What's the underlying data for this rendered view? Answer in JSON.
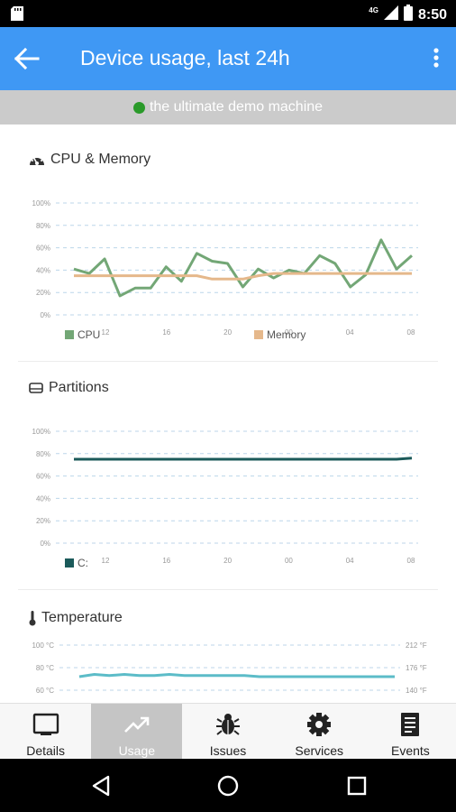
{
  "status_bar": {
    "time": "8:50",
    "network": "4G"
  },
  "app_bar": {
    "title": "Device usage, last 24h"
  },
  "device": {
    "name": "the ultimate demo machine",
    "status_color": "#2a9a2a"
  },
  "colors": {
    "primary": "#3f98f4",
    "cpu": "#73a776",
    "memory": "#e5b88b",
    "partition": "#1b5a5a",
    "temperature": "#5cbcc8",
    "grid": "#bcd6ea"
  },
  "cards": {
    "cpu_memory": {
      "title": "CPU & Memory",
      "icon": "speedometer-icon"
    },
    "partitions": {
      "title": "Partitions",
      "icon": "hard-drive-icon"
    },
    "temperature": {
      "title": "Temperature",
      "icon": "thermometer-icon"
    }
  },
  "chart_data": [
    {
      "type": "line",
      "x_ticks": [
        "12",
        "16",
        "20",
        "00",
        "04",
        "08"
      ],
      "y_ticks": [
        "100%",
        "80%",
        "60%",
        "40%",
        "20%",
        "0%"
      ],
      "ylim": [
        0,
        100
      ],
      "grid": true,
      "legend_position": "bottom",
      "series": [
        {
          "name": "CPU",
          "color": "#73a776",
          "values": [
            41,
            37,
            50,
            17,
            24,
            24,
            43,
            30,
            55,
            48,
            46,
            25,
            41,
            33,
            40,
            37,
            53,
            46,
            25,
            36,
            67,
            41,
            53
          ]
        },
        {
          "name": "Memory",
          "color": "#e5b88b",
          "values": [
            35,
            35,
            35,
            35,
            35,
            35,
            35,
            35,
            35,
            32,
            32,
            32,
            35,
            37,
            37,
            37,
            37,
            37,
            37,
            37,
            37,
            37,
            37
          ]
        }
      ]
    },
    {
      "type": "line",
      "x_ticks": [
        "12",
        "16",
        "20",
        "00",
        "04",
        "08"
      ],
      "y_ticks": [
        "100%",
        "80%",
        "60%",
        "40%",
        "20%",
        "0%"
      ],
      "ylim": [
        0,
        100
      ],
      "grid": true,
      "legend_position": "bottom",
      "series": [
        {
          "name": "C:",
          "color": "#1b5a5a",
          "values": [
            75,
            75,
            75,
            75,
            75,
            75,
            75,
            75,
            75,
            75,
            75,
            75,
            75,
            75,
            75,
            75,
            75,
            75,
            75,
            75,
            75,
            75,
            76
          ]
        }
      ]
    },
    {
      "type": "line",
      "y_ticks_left": [
        "100 °C",
        "80 °C",
        "60 °C"
      ],
      "y_ticks_right": [
        "212 °F",
        "176 °F",
        "140 °F"
      ],
      "ylim": [
        60,
        100
      ],
      "grid": true,
      "series": [
        {
          "name": "",
          "color": "#5cbcc8",
          "values": [
            72,
            74,
            73,
            74,
            73,
            73,
            74,
            73,
            73,
            73,
            73,
            73,
            72,
            72,
            72,
            72,
            72,
            72,
            72,
            72,
            72,
            72
          ]
        }
      ]
    }
  ],
  "bottom_nav": [
    {
      "label": "Details",
      "icon": "tablet-icon",
      "active": false
    },
    {
      "label": "Usage",
      "icon": "trending-up-icon",
      "active": true
    },
    {
      "label": "Issues",
      "icon": "bug-icon",
      "active": false
    },
    {
      "label": "Services",
      "icon": "gear-icon",
      "active": false
    },
    {
      "label": "Events",
      "icon": "document-list-icon",
      "active": false
    }
  ]
}
